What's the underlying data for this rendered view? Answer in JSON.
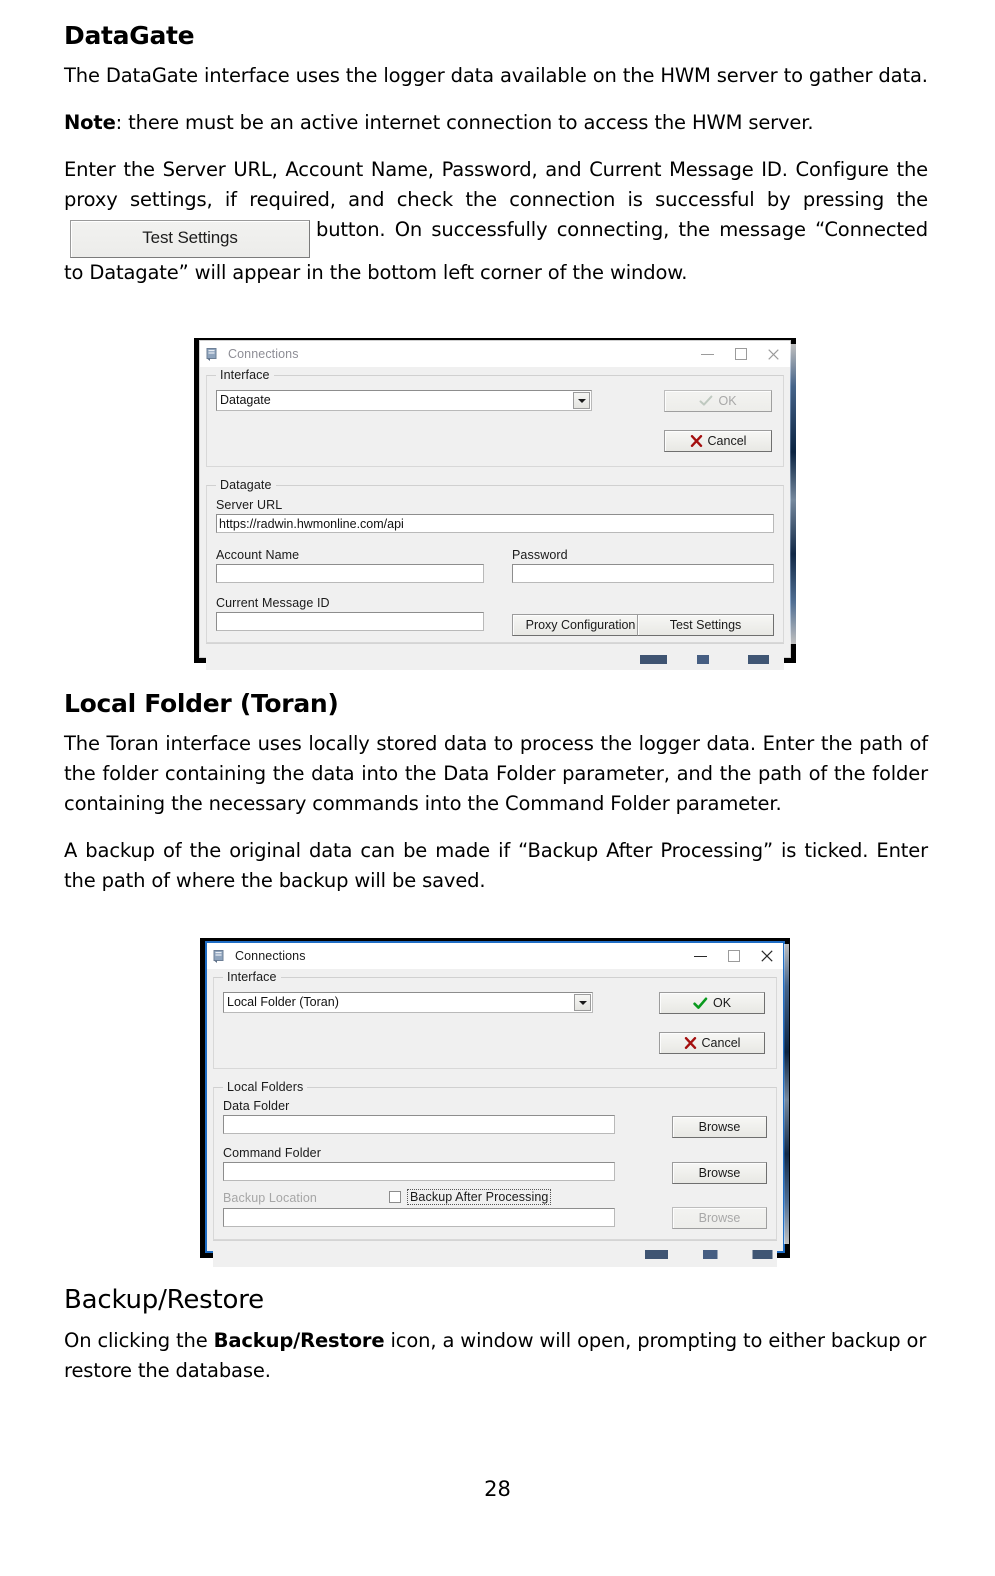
{
  "document": {
    "page_number": "28",
    "sections": [
      {
        "id": "datagate",
        "heading": "DataGate",
        "paragraphs": [
          "The DataGate interface uses the logger data available on the HWM server to gather data.",
          "Note: there must be an active internet connection to access the HWM server.",
          "Enter the Server URL, Account Name, Password, and Current Message ID. Configure the proxy settings, if required, and check the connection is successful by pressing the"
        ],
        "note_bold_lead": "Note",
        "note_rest": ": there must be an active internet connection to access the HWM server.",
        "inline_button_label": "Test Settings",
        "para_after_button": "button. On successfully connecting, the message “Connected to Datagate” will appear in the bottom left corner of the window."
      },
      {
        "id": "toran",
        "heading": "Local Folder (Toran)",
        "paragraphs": [
          "The Toran interface uses locally stored data to process the logger data. Enter the path of the folder containing the data into the Data Folder parameter, and the path of the folder containing the necessary commands into the Command Folder parameter.",
          "A backup of the original data can be made if “Backup After Processing” is ticked. Enter the path of where the backup will be saved."
        ]
      },
      {
        "id": "backup-restore",
        "heading": "Backup/Restore",
        "lead_text": "On clicking the ",
        "bold_term": "Backup/Restore",
        "trail_text": " icon, a window will open, prompting to either backup or restore the database."
      }
    ]
  },
  "dialog_datagate": {
    "title": "Connections",
    "icon": "app-window-icon",
    "window_controls": {
      "minimize": "minimize-icon",
      "maximize": "maximize-icon",
      "close": "close-icon"
    },
    "interface_group": {
      "legend": "Interface",
      "combo_value": "Datagate",
      "combo_options": [
        "Datagate",
        "Local Folder (Toran)"
      ],
      "ok_label": "OK",
      "ok_enabled": "false",
      "cancel_label": "Cancel"
    },
    "datagate_group": {
      "legend": "Datagate",
      "server_url_label": "Server URL",
      "server_url_value": "https://radwin.hwmonline.com/api",
      "account_name_label": "Account Name",
      "account_name_value": "",
      "password_label": "Password",
      "password_value": "",
      "message_id_label": "Current Message ID",
      "message_id_value": "",
      "proxy_button": "Proxy Configuration",
      "test_button": "Test Settings"
    },
    "statusbar_text": ""
  },
  "dialog_toran": {
    "title": "Connections",
    "icon": "app-window-icon",
    "window_controls": {
      "minimize": "minimize-icon",
      "maximize": "maximize-icon",
      "close": "close-icon"
    },
    "interface_group": {
      "legend": "Interface",
      "combo_value": "Local Folder (Toran)",
      "combo_options": [
        "Datagate",
        "Local Folder (Toran)"
      ],
      "ok_label": "OK",
      "ok_enabled": "true",
      "cancel_label": "Cancel"
    },
    "local_folders_group": {
      "legend": "Local Folders",
      "data_folder_label": "Data Folder",
      "data_folder_value": "",
      "data_browse_label": "Browse",
      "command_folder_label": "Command Folder",
      "command_folder_value": "",
      "command_browse_label": "Browse",
      "backup_location_label": "Backup Location",
      "backup_location_value": "",
      "backup_browse_label": "Browse",
      "backup_checkbox_label": "Backup After Processing",
      "backup_checkbox_checked": "false"
    },
    "statusbar_text": ""
  },
  "colors": {
    "dialog_face": "#f0f0f0",
    "active_border": "#1f6dc4",
    "ok_check": "#0a9a1e",
    "cancel_cross": "#b00000",
    "disabled_text": "#a8a8a8"
  }
}
